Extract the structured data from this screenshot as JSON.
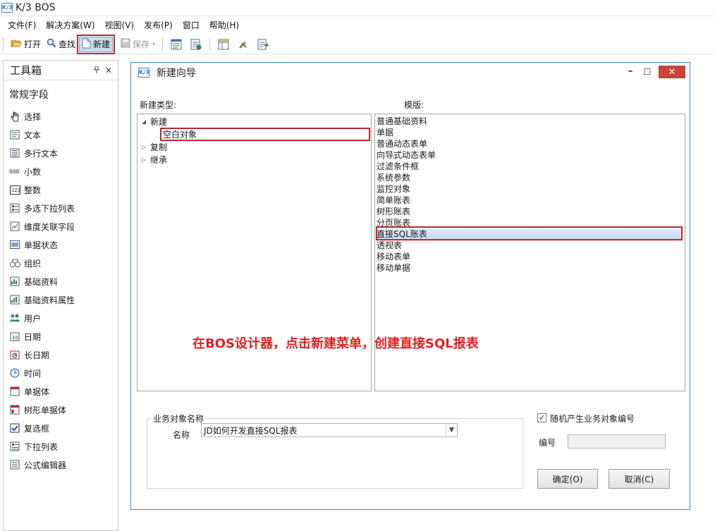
{
  "app": {
    "title": "K/3 BOS",
    "logo_text": "K/3"
  },
  "menu": [
    "文件(F)",
    "解决方案(W)",
    "视图(V)",
    "发布(P)",
    "窗口",
    "帮助(H)"
  ],
  "toolbar": {
    "open_label": "打开",
    "find_label": "查找",
    "new_label": "新建",
    "save_label": "保存"
  },
  "toolbox": {
    "title": "工具箱",
    "pin_glyph": "ᵖ",
    "close_glyph": "✕",
    "section": "常规字段",
    "items": [
      {
        "label": "选择",
        "icon": "pointer-icon"
      },
      {
        "label": "文本",
        "icon": "text-icon"
      },
      {
        "label": "多行文本",
        "icon": "multiline-text-icon"
      },
      {
        "label": "小数",
        "icon": "decimal-icon"
      },
      {
        "label": "整数",
        "icon": "integer-icon"
      },
      {
        "label": "多选下拉列表",
        "icon": "multi-select-icon"
      },
      {
        "label": "维度关联字段",
        "icon": "dimension-icon"
      },
      {
        "label": "单据状态",
        "icon": "status-icon"
      },
      {
        "label": "组织",
        "icon": "org-icon"
      },
      {
        "label": "基础资料",
        "icon": "basedata-icon"
      },
      {
        "label": "基础资料属性",
        "icon": "basedata-prop-icon"
      },
      {
        "label": "用户",
        "icon": "user-icon"
      },
      {
        "label": "日期",
        "icon": "date-icon"
      },
      {
        "label": "长日期",
        "icon": "longdate-icon"
      },
      {
        "label": "时间",
        "icon": "clock-icon"
      },
      {
        "label": "单据体",
        "icon": "entry-icon"
      },
      {
        "label": "树形单据体",
        "icon": "tree-entry-icon"
      },
      {
        "label": "复选框",
        "icon": "checkbox-icon"
      },
      {
        "label": "下拉列表",
        "icon": "dropdown-icon"
      },
      {
        "label": "公式编辑器",
        "icon": "formula-icon"
      }
    ]
  },
  "dialog": {
    "title": "新建向导",
    "logo_text": "K/3",
    "min_glyph": "━",
    "max_glyph": "☐",
    "close_glyph": "✕",
    "type_label": "新建类型:",
    "template_label": "模版:",
    "tree": [
      {
        "label": "新建",
        "expanded": true
      },
      {
        "label": "空白对象",
        "child": true,
        "selected": true
      },
      {
        "label": "复制",
        "expanded": false
      },
      {
        "label": "继承",
        "expanded": false
      }
    ],
    "templates": [
      "普通基础资料",
      "单据",
      "普通动态表单",
      "向导式动态表单",
      "过滤条件框",
      "系统参数",
      "监控对象",
      "简单账表",
      "树形账表",
      "分页账表",
      "直接SQL账表",
      "透视表",
      "移动表单",
      "移动单据"
    ],
    "selected_template": "直接SQL账表",
    "annotation": "在BOS设计器，点击新建菜单，创建直接SQL报表",
    "group_title": "业务对象名称",
    "name_label": "名称",
    "name_value": "JD如何开发直接SQL报表",
    "random_label": "随机产生业务对象编号",
    "random_checked": true,
    "number_label": "编号",
    "number_value": "",
    "ok_label": "确定(O)",
    "cancel_label": "取消(C)"
  },
  "colors": {
    "highlight_red": "#c0272d",
    "annotation_red": "#e02020",
    "accent_blue": "#3e87c7"
  }
}
